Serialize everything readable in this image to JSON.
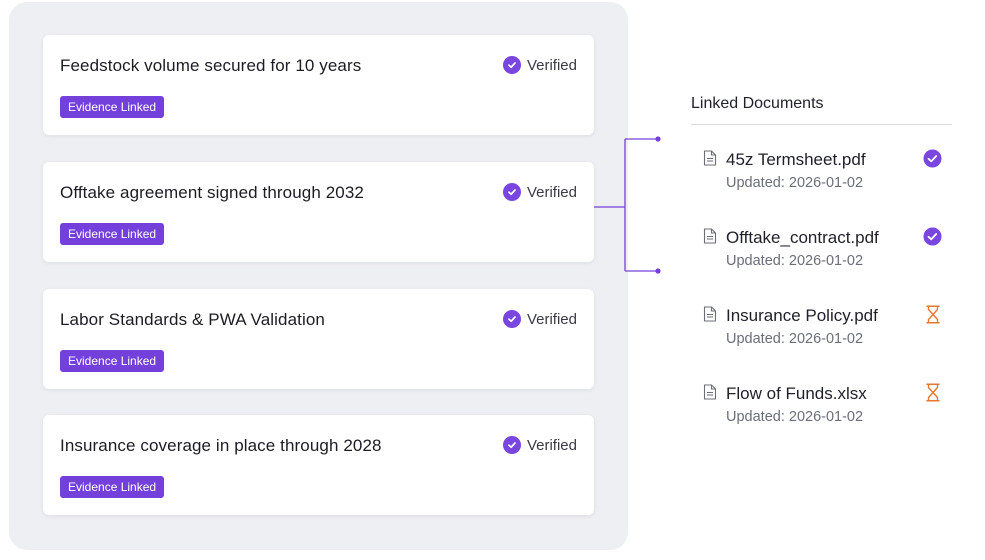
{
  "claims": [
    {
      "title": "Feedstock volume secured for 10 years",
      "status": "Verified",
      "badge": "Evidence Linked"
    },
    {
      "title": "Offtake agreement signed through 2032",
      "status": "Verified",
      "badge": "Evidence Linked"
    },
    {
      "title": "Labor Standards & PWA Validation",
      "status": "Verified",
      "badge": "Evidence Linked"
    },
    {
      "title": "Insurance coverage in place through 2028",
      "status": "Verified",
      "badge": "Evidence Linked"
    }
  ],
  "linked_documents": {
    "title": "Linked Documents",
    "items": [
      {
        "name": "45z Termsheet.pdf",
        "updated": "Updated: 2026-01-02",
        "status_icon": "check-circle-icon"
      },
      {
        "name": "Offtake_contract.pdf",
        "updated": "Updated: 2026-01-02",
        "status_icon": "check-circle-icon"
      },
      {
        "name": "Insurance Policy.pdf",
        "updated": "Updated: 2026-01-02",
        "status_icon": "hourglass-icon"
      },
      {
        "name": "Flow of Funds.xlsx",
        "updated": "Updated: 2026-01-02",
        "status_icon": "hourglass-icon"
      }
    ]
  },
  "colors": {
    "accent_purple": "#7340dc",
    "verified_purple": "#7a46e0",
    "pending_orange": "#e8782e",
    "panel_grey": "#eeeff2"
  }
}
